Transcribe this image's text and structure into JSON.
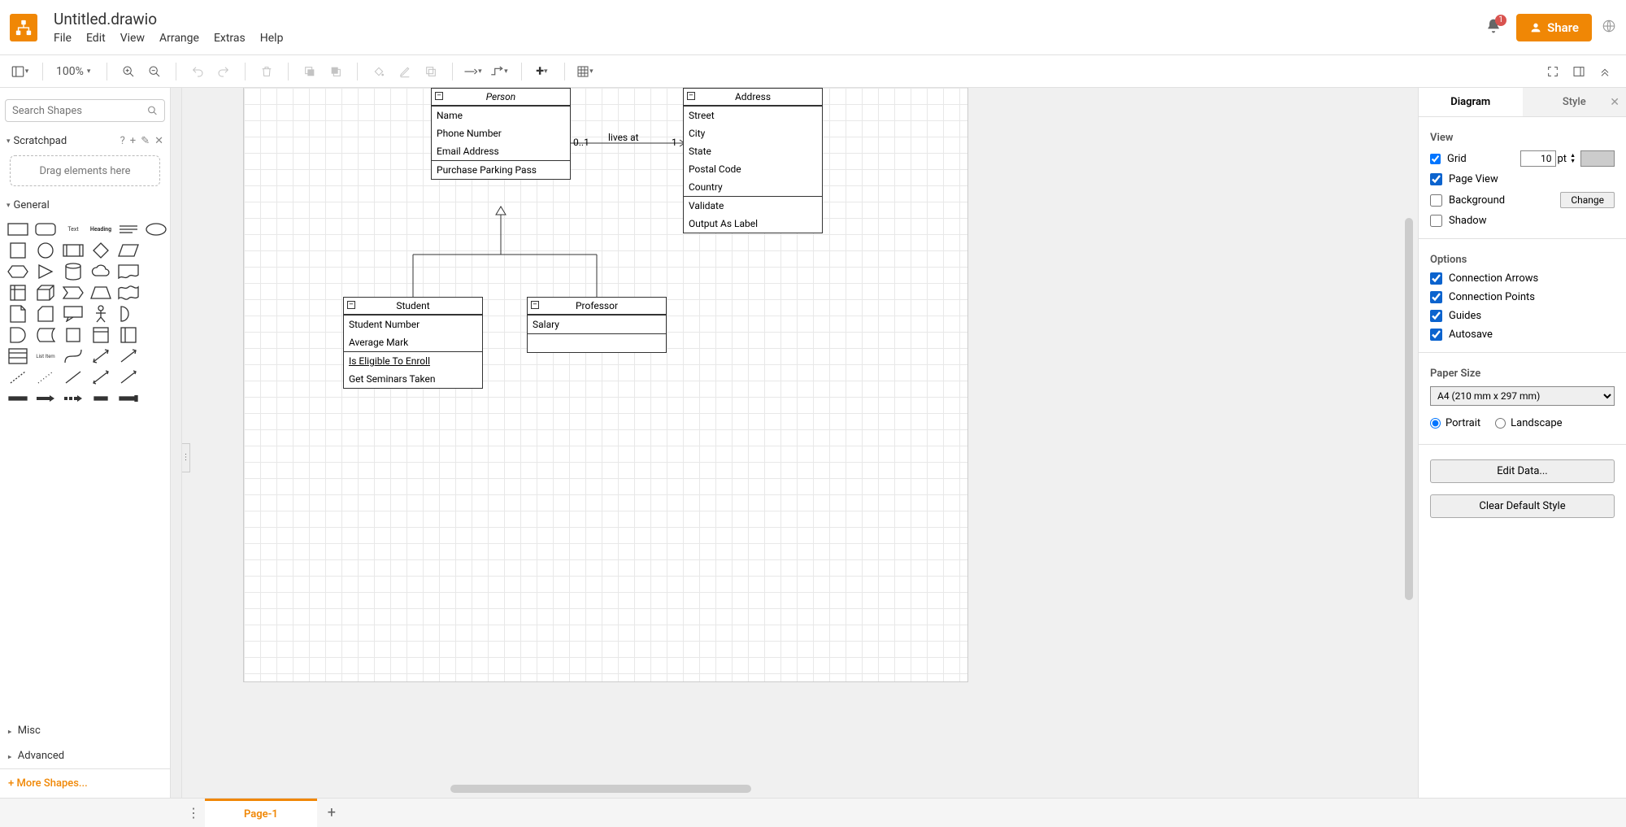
{
  "header": {
    "title": "Untitled.drawio",
    "menu": [
      "File",
      "Edit",
      "View",
      "Arrange",
      "Extras",
      "Help"
    ],
    "notification_count": "1",
    "share_label": "Share"
  },
  "toolbar": {
    "zoom": "100%"
  },
  "left": {
    "search_placeholder": "Search Shapes",
    "scratchpad_label": "Scratchpad",
    "scratchpad_drop": "Drag elements here",
    "groups": {
      "general": "General",
      "misc": "Misc",
      "advanced": "Advanced"
    },
    "shape_labels": {
      "text": "Text",
      "heading": "Heading",
      "list_item": "List Item"
    },
    "more_shapes": "More Shapes..."
  },
  "canvas": {
    "person": {
      "title": "Person",
      "attrs": [
        "Name",
        "Phone Number",
        "Email Address"
      ],
      "ops": [
        "Purchase Parking Pass"
      ]
    },
    "address": {
      "title": "Address",
      "attrs": [
        "Street",
        "City",
        "State",
        "Postal Code",
        "Country"
      ],
      "ops": [
        "Validate",
        "Output As Label"
      ]
    },
    "student": {
      "title": "Student",
      "attrs": [
        "Student Number",
        "Average Mark"
      ],
      "ops": [
        "Is Eligible To Enroll",
        "Get Seminars Taken"
      ]
    },
    "professor": {
      "title": "Professor",
      "attrs": [
        "Salary"
      ]
    },
    "assoc": {
      "label": "lives at",
      "left_mult": "0..1",
      "right_mult": "1"
    }
  },
  "right": {
    "tabs": {
      "diagram": "Diagram",
      "style": "Style"
    },
    "view_label": "View",
    "grid": "Grid",
    "grid_size": "10",
    "grid_unit": "pt",
    "page_view": "Page View",
    "background": "Background",
    "change": "Change",
    "shadow": "Shadow",
    "options_label": "Options",
    "conn_arrows": "Connection Arrows",
    "conn_points": "Connection Points",
    "guides": "Guides",
    "autosave": "Autosave",
    "paper_size_label": "Paper Size",
    "paper_size_value": "A4 (210 mm x 297 mm)",
    "portrait": "Portrait",
    "landscape": "Landscape",
    "edit_data": "Edit Data...",
    "clear_style": "Clear Default Style"
  },
  "footer": {
    "page_tab": "Page-1"
  }
}
